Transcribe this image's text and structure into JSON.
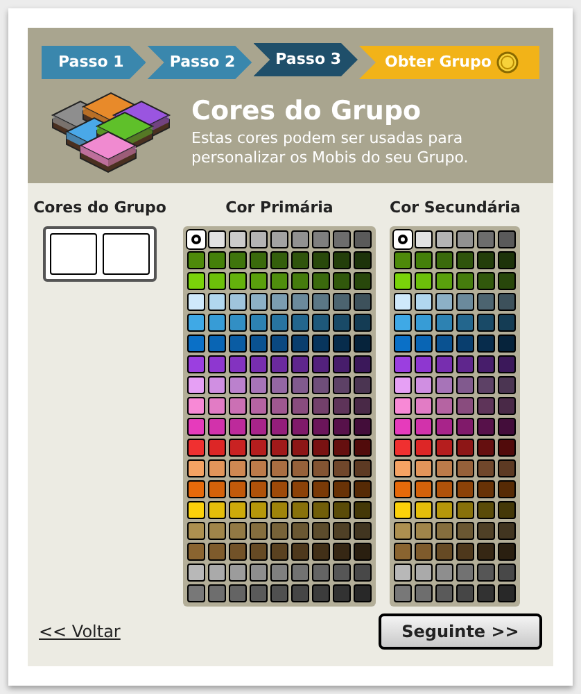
{
  "steps": [
    {
      "label": "Passo 1",
      "kind": "step",
      "selected": false
    },
    {
      "label": "Passo 2",
      "kind": "step",
      "selected": false
    },
    {
      "label": "Passo 3",
      "kind": "step",
      "selected": true
    },
    {
      "label": "Obter Grupo",
      "kind": "final",
      "selected": false
    }
  ],
  "header": {
    "title": "Cores do Grupo",
    "description": "Estas cores podem ser usadas para personalizar os Mobis do seu Grupo."
  },
  "preview": {
    "title": "Cores do Grupo",
    "swatches": [
      {
        "color": "#ffffff"
      },
      {
        "color": "#ffffff"
      }
    ]
  },
  "primary_palette": {
    "title": "Cor Primária",
    "rows": [
      [
        {
          "color": "#ffffff",
          "selected": true
        },
        {
          "color": "#e2e2e2",
          "selected": false
        },
        {
          "color": "#cbcbcb",
          "selected": false
        },
        {
          "color": "#b4b4b4",
          "selected": false
        },
        {
          "color": "#a2a2a2",
          "selected": false
        },
        {
          "color": "#919191",
          "selected": false
        },
        {
          "color": "#7f7f7f",
          "selected": false
        },
        {
          "color": "#6d6d6d",
          "selected": false
        },
        {
          "color": "#5a5a5a",
          "selected": false
        }
      ],
      [
        {
          "color": "#4e8a0a",
          "selected": false
        },
        {
          "color": "#44800a",
          "selected": false
        },
        {
          "color": "#3f750c",
          "selected": false
        },
        {
          "color": "#3a6a0c",
          "selected": false
        },
        {
          "color": "#345f0c",
          "selected": false
        },
        {
          "color": "#2f540c",
          "selected": false
        },
        {
          "color": "#29490b",
          "selected": false
        },
        {
          "color": "#233e0a",
          "selected": false
        },
        {
          "color": "#1d330a",
          "selected": false
        }
      ],
      [
        {
          "color": "#7ad30a",
          "selected": false
        },
        {
          "color": "#6cc00a",
          "selected": false
        },
        {
          "color": "#64b20c",
          "selected": false
        },
        {
          "color": "#5aa00d",
          "selected": false
        },
        {
          "color": "#4f8e0d",
          "selected": false
        },
        {
          "color": "#457c0d",
          "selected": false
        },
        {
          "color": "#3b6a0d",
          "selected": false
        },
        {
          "color": "#31580c",
          "selected": false
        },
        {
          "color": "#28470b",
          "selected": false
        }
      ],
      [
        {
          "color": "#cfe9fb",
          "selected": false
        },
        {
          "color": "#b1d7ef",
          "selected": false
        },
        {
          "color": "#9fc4dc",
          "selected": false
        },
        {
          "color": "#8cb0c6",
          "selected": false
        },
        {
          "color": "#7b9db1",
          "selected": false
        },
        {
          "color": "#6b8a9c",
          "selected": false
        },
        {
          "color": "#5b7786",
          "selected": false
        },
        {
          "color": "#4c6470",
          "selected": false
        },
        {
          "color": "#3d515b",
          "selected": false
        }
      ],
      [
        {
          "color": "#3fa9e6",
          "selected": false
        },
        {
          "color": "#379cd6",
          "selected": false
        },
        {
          "color": "#328fc4",
          "selected": false
        },
        {
          "color": "#2d82b2",
          "selected": false
        },
        {
          "color": "#2874a0",
          "selected": false
        },
        {
          "color": "#23668d",
          "selected": false
        },
        {
          "color": "#1e587a",
          "selected": false
        },
        {
          "color": "#194a67",
          "selected": false
        },
        {
          "color": "#143c54",
          "selected": false
        }
      ],
      [
        {
          "color": "#0a70c7",
          "selected": false
        },
        {
          "color": "#0965b4",
          "selected": false
        },
        {
          "color": "#0a5ca3",
          "selected": false
        },
        {
          "color": "#0a5291",
          "selected": false
        },
        {
          "color": "#0a4880",
          "selected": false
        },
        {
          "color": "#093e6e",
          "selected": false
        },
        {
          "color": "#08355d",
          "selected": false
        },
        {
          "color": "#072c4c",
          "selected": false
        },
        {
          "color": "#06233b",
          "selected": false
        }
      ],
      [
        {
          "color": "#9b3fe0",
          "selected": false
        },
        {
          "color": "#8e37d0",
          "selected": false
        },
        {
          "color": "#8333c0",
          "selected": false
        },
        {
          "color": "#772eaf",
          "selected": false
        },
        {
          "color": "#6b2a9e",
          "selected": false
        },
        {
          "color": "#5f268d",
          "selected": false
        },
        {
          "color": "#53217c",
          "selected": false
        },
        {
          "color": "#471d6b",
          "selected": false
        },
        {
          "color": "#3b185a",
          "selected": false
        }
      ],
      [
        {
          "color": "#e6a0f5",
          "selected": false
        },
        {
          "color": "#d08fe2",
          "selected": false
        },
        {
          "color": "#bb81cd",
          "selected": false
        },
        {
          "color": "#a774b8",
          "selected": false
        },
        {
          "color": "#9467a3",
          "selected": false
        },
        {
          "color": "#815a8e",
          "selected": false
        },
        {
          "color": "#6f4e7a",
          "selected": false
        },
        {
          "color": "#5d4166",
          "selected": false
        },
        {
          "color": "#4b3552",
          "selected": false
        }
      ],
      [
        {
          "color": "#f889d6",
          "selected": false
        },
        {
          "color": "#e27cc5",
          "selected": false
        },
        {
          "color": "#cb70b4",
          "selected": false
        },
        {
          "color": "#b564a2",
          "selected": false
        },
        {
          "color": "#9f5890",
          "selected": false
        },
        {
          "color": "#894c7e",
          "selected": false
        },
        {
          "color": "#73406b",
          "selected": false
        },
        {
          "color": "#5e3459",
          "selected": false
        },
        {
          "color": "#492947",
          "selected": false
        }
      ],
      [
        {
          "color": "#e63bbc",
          "selected": false
        },
        {
          "color": "#d232ab",
          "selected": false
        },
        {
          "color": "#bd2a9b",
          "selected": false
        },
        {
          "color": "#a8248a",
          "selected": false
        },
        {
          "color": "#941e7a",
          "selected": false
        },
        {
          "color": "#801a6a",
          "selected": false
        },
        {
          "color": "#6b155a",
          "selected": false
        },
        {
          "color": "#57114a",
          "selected": false
        },
        {
          "color": "#430d3a",
          "selected": false
        }
      ],
      [
        {
          "color": "#f03030",
          "selected": false
        },
        {
          "color": "#dd2626",
          "selected": false
        },
        {
          "color": "#c92222",
          "selected": false
        },
        {
          "color": "#b51e1e",
          "selected": false
        },
        {
          "color": "#a11a1a",
          "selected": false
        },
        {
          "color": "#8d1616",
          "selected": false
        },
        {
          "color": "#791212",
          "selected": false
        },
        {
          "color": "#650f0f",
          "selected": false
        },
        {
          "color": "#510b0b",
          "selected": false
        }
      ],
      [
        {
          "color": "#f5a363",
          "selected": false
        },
        {
          "color": "#e2955a",
          "selected": false
        },
        {
          "color": "#cf8852",
          "selected": false
        },
        {
          "color": "#bc7b4a",
          "selected": false
        },
        {
          "color": "#a96e42",
          "selected": false
        },
        {
          "color": "#96613a",
          "selected": false
        },
        {
          "color": "#835432",
          "selected": false
        },
        {
          "color": "#70472b",
          "selected": false
        },
        {
          "color": "#5d3a23",
          "selected": false
        }
      ],
      [
        {
          "color": "#e66a0a",
          "selected": false
        },
        {
          "color": "#d4620a",
          "selected": false
        },
        {
          "color": "#c25a0a",
          "selected": false
        },
        {
          "color": "#b0520a",
          "selected": false
        },
        {
          "color": "#9e4a09",
          "selected": false
        },
        {
          "color": "#8c4208",
          "selected": false
        },
        {
          "color": "#7a3a07",
          "selected": false
        },
        {
          "color": "#683206",
          "selected": false
        },
        {
          "color": "#562a05",
          "selected": false
        }
      ],
      [
        {
          "color": "#fcd10a",
          "selected": false
        },
        {
          "color": "#e5be0a",
          "selected": false
        },
        {
          "color": "#cdaa0a",
          "selected": false
        },
        {
          "color": "#b6970a",
          "selected": false
        },
        {
          "color": "#9f840a",
          "selected": false
        },
        {
          "color": "#88710a",
          "selected": false
        },
        {
          "color": "#715e09",
          "selected": false
        },
        {
          "color": "#5a4b08",
          "selected": false
        },
        {
          "color": "#443807",
          "selected": false
        }
      ],
      [
        {
          "color": "#ad9050",
          "selected": false
        },
        {
          "color": "#a0854a",
          "selected": false
        },
        {
          "color": "#927944",
          "selected": false
        },
        {
          "color": "#856e3e",
          "selected": false
        },
        {
          "color": "#776238",
          "selected": false
        },
        {
          "color": "#6a5732",
          "selected": false
        },
        {
          "color": "#5c4c2c",
          "selected": false
        },
        {
          "color": "#4f4026",
          "selected": false
        },
        {
          "color": "#413520",
          "selected": false
        }
      ],
      [
        {
          "color": "#8a6430",
          "selected": false
        },
        {
          "color": "#7e5b2c",
          "selected": false
        },
        {
          "color": "#725228",
          "selected": false
        },
        {
          "color": "#664a24",
          "selected": false
        },
        {
          "color": "#5a4120",
          "selected": false
        },
        {
          "color": "#4e381c",
          "selected": false
        },
        {
          "color": "#423018",
          "selected": false
        },
        {
          "color": "#362714",
          "selected": false
        },
        {
          "color": "#2a1f10",
          "selected": false
        }
      ],
      [
        {
          "color": "#b8b8b8",
          "selected": false
        },
        {
          "color": "#aaaaaa",
          "selected": false
        },
        {
          "color": "#9c9c9c",
          "selected": false
        },
        {
          "color": "#8e8e8e",
          "selected": false
        },
        {
          "color": "#808080",
          "selected": false
        },
        {
          "color": "#727272",
          "selected": false
        },
        {
          "color": "#646464",
          "selected": false
        },
        {
          "color": "#565656",
          "selected": false
        },
        {
          "color": "#484848",
          "selected": false
        }
      ],
      [
        {
          "color": "#787878",
          "selected": false
        },
        {
          "color": "#6e6e6e",
          "selected": false
        },
        {
          "color": "#646464",
          "selected": false
        },
        {
          "color": "#5a5a5a",
          "selected": false
        },
        {
          "color": "#505050",
          "selected": false
        },
        {
          "color": "#464646",
          "selected": false
        },
        {
          "color": "#3c3c3c",
          "selected": false
        },
        {
          "color": "#323232",
          "selected": false
        },
        {
          "color": "#282828",
          "selected": false
        }
      ]
    ]
  },
  "secondary_palette": {
    "title": "Cor Secundária",
    "rows": [
      [
        {
          "color": "#ffffff",
          "selected": true
        },
        {
          "color": "#e2e2e2",
          "selected": false
        },
        {
          "color": "#b4b4b4",
          "selected": false
        },
        {
          "color": "#919191",
          "selected": false
        },
        {
          "color": "#6d6d6d",
          "selected": false
        },
        {
          "color": "#5a5a5a",
          "selected": false
        }
      ],
      [
        {
          "color": "#4e8a0a",
          "selected": false
        },
        {
          "color": "#44800a",
          "selected": false
        },
        {
          "color": "#3a6a0c",
          "selected": false
        },
        {
          "color": "#2f540c",
          "selected": false
        },
        {
          "color": "#233e0a",
          "selected": false
        },
        {
          "color": "#1d330a",
          "selected": false
        }
      ],
      [
        {
          "color": "#7ad30a",
          "selected": false
        },
        {
          "color": "#6cc00a",
          "selected": false
        },
        {
          "color": "#5aa00d",
          "selected": false
        },
        {
          "color": "#457c0d",
          "selected": false
        },
        {
          "color": "#31580c",
          "selected": false
        },
        {
          "color": "#28470b",
          "selected": false
        }
      ],
      [
        {
          "color": "#cfe9fb",
          "selected": false
        },
        {
          "color": "#b1d7ef",
          "selected": false
        },
        {
          "color": "#8cb0c6",
          "selected": false
        },
        {
          "color": "#6b8a9c",
          "selected": false
        },
        {
          "color": "#4c6470",
          "selected": false
        },
        {
          "color": "#3d515b",
          "selected": false
        }
      ],
      [
        {
          "color": "#3fa9e6",
          "selected": false
        },
        {
          "color": "#379cd6",
          "selected": false
        },
        {
          "color": "#2d82b2",
          "selected": false
        },
        {
          "color": "#23668d",
          "selected": false
        },
        {
          "color": "#194a67",
          "selected": false
        },
        {
          "color": "#143c54",
          "selected": false
        }
      ],
      [
        {
          "color": "#0a70c7",
          "selected": false
        },
        {
          "color": "#0965b4",
          "selected": false
        },
        {
          "color": "#0a5291",
          "selected": false
        },
        {
          "color": "#093e6e",
          "selected": false
        },
        {
          "color": "#072c4c",
          "selected": false
        },
        {
          "color": "#06233b",
          "selected": false
        }
      ],
      [
        {
          "color": "#9b3fe0",
          "selected": false
        },
        {
          "color": "#8e37d0",
          "selected": false
        },
        {
          "color": "#772eaf",
          "selected": false
        },
        {
          "color": "#5f268d",
          "selected": false
        },
        {
          "color": "#471d6b",
          "selected": false
        },
        {
          "color": "#3b185a",
          "selected": false
        }
      ],
      [
        {
          "color": "#e6a0f5",
          "selected": false
        },
        {
          "color": "#d08fe2",
          "selected": false
        },
        {
          "color": "#a774b8",
          "selected": false
        },
        {
          "color": "#815a8e",
          "selected": false
        },
        {
          "color": "#5d4166",
          "selected": false
        },
        {
          "color": "#4b3552",
          "selected": false
        }
      ],
      [
        {
          "color": "#f889d6",
          "selected": false
        },
        {
          "color": "#e27cc5",
          "selected": false
        },
        {
          "color": "#b564a2",
          "selected": false
        },
        {
          "color": "#894c7e",
          "selected": false
        },
        {
          "color": "#5e3459",
          "selected": false
        },
        {
          "color": "#492947",
          "selected": false
        }
      ],
      [
        {
          "color": "#e63bbc",
          "selected": false
        },
        {
          "color": "#d232ab",
          "selected": false
        },
        {
          "color": "#a8248a",
          "selected": false
        },
        {
          "color": "#801a6a",
          "selected": false
        },
        {
          "color": "#57114a",
          "selected": false
        },
        {
          "color": "#430d3a",
          "selected": false
        }
      ],
      [
        {
          "color": "#f03030",
          "selected": false
        },
        {
          "color": "#dd2626",
          "selected": false
        },
        {
          "color": "#b51e1e",
          "selected": false
        },
        {
          "color": "#8d1616",
          "selected": false
        },
        {
          "color": "#650f0f",
          "selected": false
        },
        {
          "color": "#510b0b",
          "selected": false
        }
      ],
      [
        {
          "color": "#f5a363",
          "selected": false
        },
        {
          "color": "#e2955a",
          "selected": false
        },
        {
          "color": "#bc7b4a",
          "selected": false
        },
        {
          "color": "#96613a",
          "selected": false
        },
        {
          "color": "#70472b",
          "selected": false
        },
        {
          "color": "#5d3a23",
          "selected": false
        }
      ],
      [
        {
          "color": "#e66a0a",
          "selected": false
        },
        {
          "color": "#d4620a",
          "selected": false
        },
        {
          "color": "#b0520a",
          "selected": false
        },
        {
          "color": "#8c4208",
          "selected": false
        },
        {
          "color": "#683206",
          "selected": false
        },
        {
          "color": "#562a05",
          "selected": false
        }
      ],
      [
        {
          "color": "#fcd10a",
          "selected": false
        },
        {
          "color": "#e5be0a",
          "selected": false
        },
        {
          "color": "#b6970a",
          "selected": false
        },
        {
          "color": "#88710a",
          "selected": false
        },
        {
          "color": "#5a4b08",
          "selected": false
        },
        {
          "color": "#443807",
          "selected": false
        }
      ],
      [
        {
          "color": "#ad9050",
          "selected": false
        },
        {
          "color": "#a0854a",
          "selected": false
        },
        {
          "color": "#856e3e",
          "selected": false
        },
        {
          "color": "#6a5732",
          "selected": false
        },
        {
          "color": "#4f4026",
          "selected": false
        },
        {
          "color": "#413520",
          "selected": false
        }
      ],
      [
        {
          "color": "#8a6430",
          "selected": false
        },
        {
          "color": "#7e5b2c",
          "selected": false
        },
        {
          "color": "#664a24",
          "selected": false
        },
        {
          "color": "#4e381c",
          "selected": false
        },
        {
          "color": "#362714",
          "selected": false
        },
        {
          "color": "#2a1f10",
          "selected": false
        }
      ],
      [
        {
          "color": "#b8b8b8",
          "selected": false
        },
        {
          "color": "#aaaaaa",
          "selected": false
        },
        {
          "color": "#8e8e8e",
          "selected": false
        },
        {
          "color": "#727272",
          "selected": false
        },
        {
          "color": "#565656",
          "selected": false
        },
        {
          "color": "#484848",
          "selected": false
        }
      ],
      [
        {
          "color": "#787878",
          "selected": false
        },
        {
          "color": "#6e6e6e",
          "selected": false
        },
        {
          "color": "#5a5a5a",
          "selected": false
        },
        {
          "color": "#464646",
          "selected": false
        },
        {
          "color": "#323232",
          "selected": false
        },
        {
          "color": "#282828",
          "selected": false
        }
      ]
    ]
  },
  "back_link": "<< Voltar",
  "next_button": "Seguinte >>"
}
